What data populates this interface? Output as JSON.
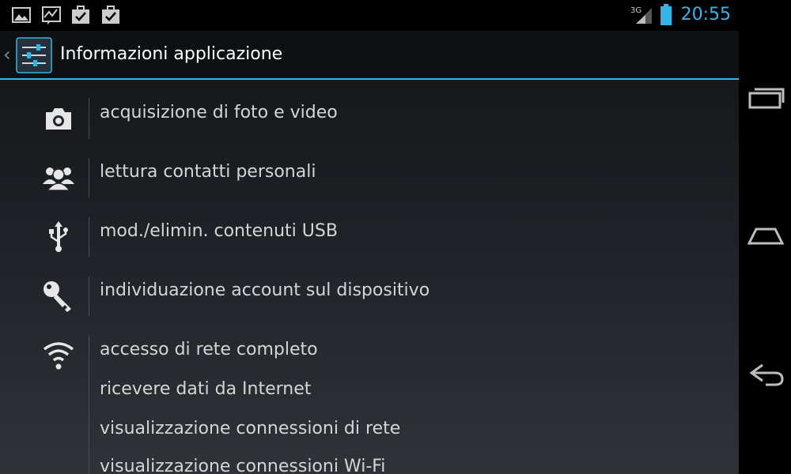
{
  "status_bar": {
    "notification_icons": [
      "gallery-icon",
      "activity-icon",
      "briefcase-check-icon",
      "briefcase-check-icon"
    ],
    "network_label": "3G",
    "time": "20:55",
    "accent": "#33b5e5"
  },
  "action_bar": {
    "title": "Informazioni applicazione",
    "app_icon": "settings-sliders-icon"
  },
  "permission_groups": [
    {
      "icon": "camera-icon",
      "items": [
        "acquisizione di foto e video"
      ]
    },
    {
      "icon": "contacts-icon",
      "items": [
        "lettura contatti personali"
      ]
    },
    {
      "icon": "usb-icon",
      "items": [
        "mod./elimin. contenuti USB"
      ]
    },
    {
      "icon": "key-icon",
      "items": [
        "individuazione account sul dispositivo"
      ]
    },
    {
      "icon": "wifi-icon",
      "items": [
        "accesso di rete completo",
        "ricevere dati da Internet",
        "visualizzazione connessioni di rete",
        "visualizzazione connessioni Wi-Fi"
      ]
    }
  ],
  "nav_bar": {
    "buttons": [
      "recent-apps-icon",
      "home-icon",
      "back-icon"
    ]
  }
}
